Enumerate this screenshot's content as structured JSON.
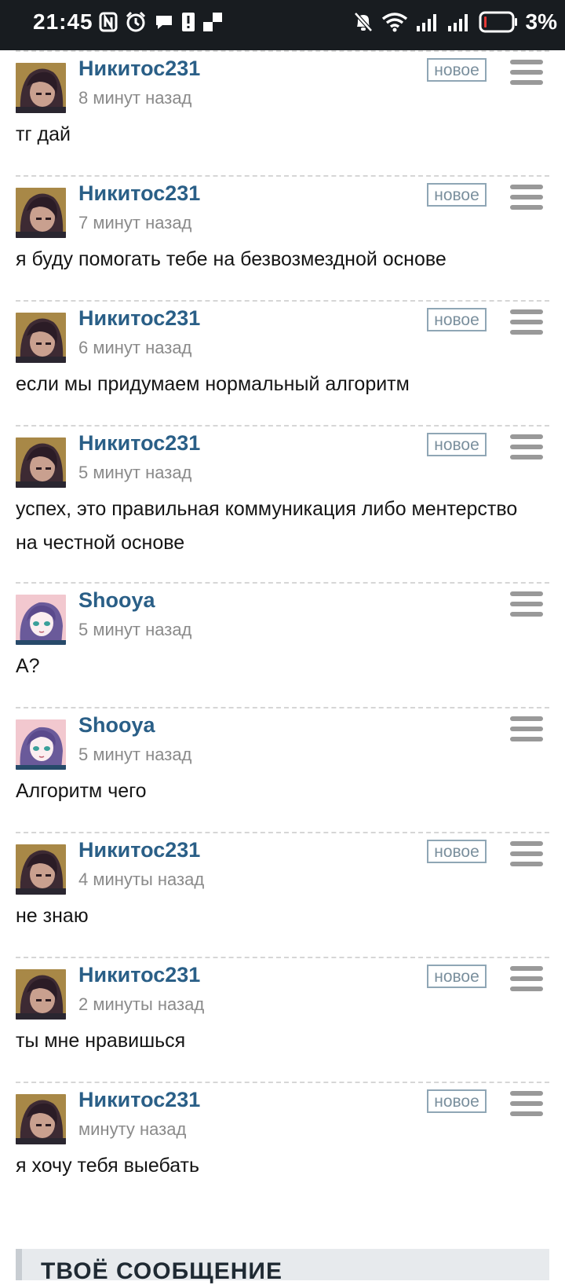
{
  "status_bar": {
    "time": "21:45",
    "battery_percent": "3%",
    "icons": [
      "nfc-icon",
      "alarm-icon",
      "chat-bubble-icon",
      "sim-alert-icon",
      "checker-icon",
      "bell-off-icon",
      "wifi-icon",
      "signal-icon",
      "signal-icon",
      "battery-low-icon"
    ]
  },
  "new_badge": "новое",
  "posts": [
    {
      "author": "Никитос231",
      "time": "8 минут назад",
      "new": true,
      "avatar": "anime-dark-avatar",
      "text": "тг дай"
    },
    {
      "author": "Никитос231",
      "time": "7 минут назад",
      "new": true,
      "avatar": "anime-dark-avatar",
      "text": "я буду помогать тебе на безвозмездной основе"
    },
    {
      "author": "Никитос231",
      "time": "6 минут назад",
      "new": true,
      "avatar": "anime-dark-avatar",
      "text": "если мы придумаем нормальный алгоритм"
    },
    {
      "author": "Никитос231",
      "time": "5 минут назад",
      "new": true,
      "avatar": "anime-dark-avatar",
      "text": "успех, это правильная коммуникация либо ментерство на честной основе"
    },
    {
      "author": "Shooya",
      "time": "5 минут назад",
      "new": false,
      "avatar": "anime-pink-avatar",
      "text": "А?"
    },
    {
      "author": "Shooya",
      "time": "5 минут назад",
      "new": false,
      "avatar": "anime-pink-avatar",
      "text": "Алгоритм чего"
    },
    {
      "author": "Никитос231",
      "time": "4 минуты назад",
      "new": true,
      "avatar": "anime-dark-avatar",
      "text": "не знаю"
    },
    {
      "author": "Никитос231",
      "time": "2 минуты назад",
      "new": true,
      "avatar": "anime-dark-avatar",
      "text": "ты мне нравишься"
    },
    {
      "author": "Никитос231",
      "time": "минуту назад",
      "new": true,
      "avatar": "anime-dark-avatar",
      "text": "я хочу тебя выебать"
    }
  ],
  "compose": {
    "title": "Твоё сообщение"
  },
  "colors": {
    "author": "#2a5f87",
    "status_bar": "#181c20",
    "battery_low": "#e53935"
  }
}
